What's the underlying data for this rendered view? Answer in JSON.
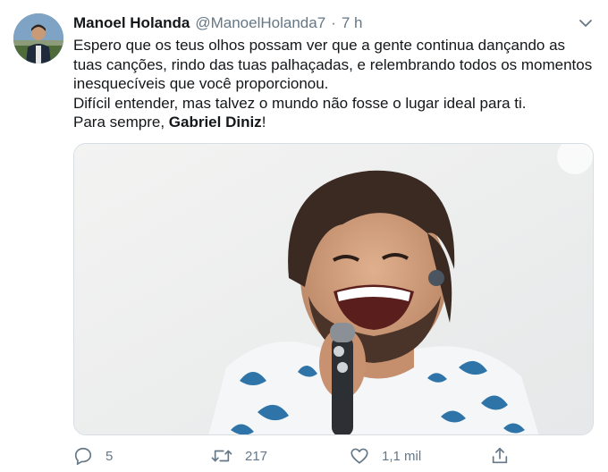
{
  "tweet": {
    "author_name": "Manoel Holanda",
    "author_handle": "@ManoelHolanda7",
    "separator": "·",
    "time": "7 h",
    "text_lines": [
      "Espero que os teus olhos possam ver que a gente continua dançando as tuas canções, rindo das tuas palhaçadas, e relembrando todos os momentos inesquecíveis que você proporcionou.",
      "Difícil entender, mas talvez o mundo não fosse o lugar ideal para ti."
    ],
    "closing_prefix": "Para sempre, ",
    "closing_name": "Gabriel Diniz",
    "closing_suffix": "!"
  },
  "icons": {
    "caret": "chevron-down-icon",
    "reply": "reply-icon",
    "retweet": "retweet-icon",
    "like": "heart-icon",
    "share": "share-icon"
  },
  "actions": {
    "reply_count": "5",
    "retweet_count": "217",
    "like_count": "1,1 mil"
  },
  "colors": {
    "text": "#14171a",
    "secondary": "#657786",
    "border": "#d6dde3"
  }
}
